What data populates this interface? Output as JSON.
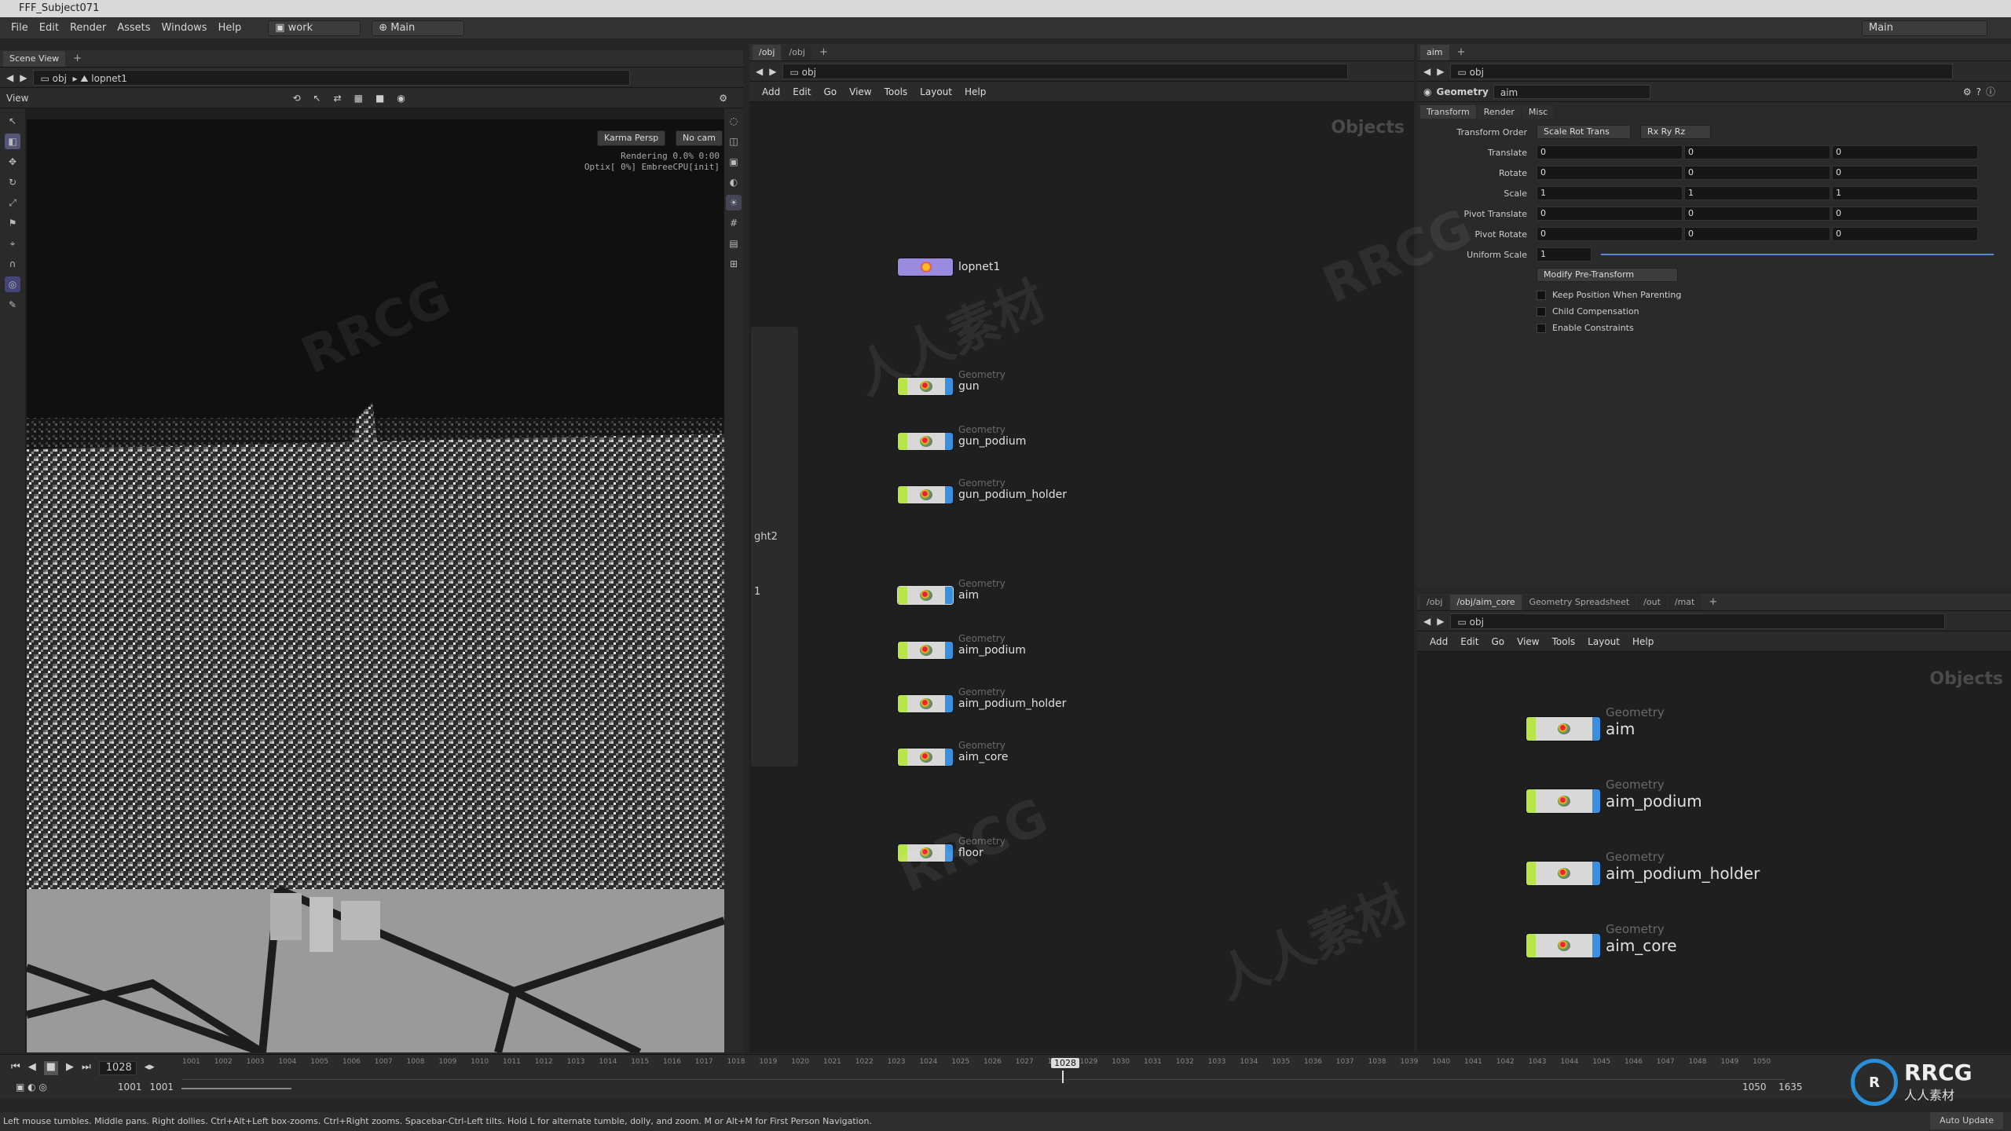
{
  "titlebar": {
    "title": "FFF_Subject071"
  },
  "menu": {
    "items": [
      "File",
      "Edit",
      "Render",
      "Assets",
      "Windows",
      "Help"
    ],
    "desktop": "work",
    "main": "Main",
    "right_main": "Main"
  },
  "scene_view": {
    "tab": "Scene View",
    "path_root": "obj",
    "path_node": "lopnet1",
    "view_label": "View",
    "renderer": "Karma Persp",
    "camera": "No cam",
    "render_status_line1": "Rendering  0.0%  0:00",
    "render_status_line2": "Optix[  0%] EmbreeCPU[init]"
  },
  "network_top": {
    "tabs": [
      "/obj",
      "/obj"
    ],
    "path": "obj",
    "menu": [
      "Add",
      "Edit",
      "Go",
      "View",
      "Tools",
      "Layout",
      "Help"
    ],
    "context_label": "Objects",
    "side_label_1": "ght2",
    "side_label_2": "1",
    "nodes": [
      {
        "type": "",
        "name": "lopnet1"
      },
      {
        "type": "Geometry",
        "name": "gun"
      },
      {
        "type": "Geometry",
        "name": "gun_podium"
      },
      {
        "type": "Geometry",
        "name": "gun_podium_holder"
      },
      {
        "type": "Geometry",
        "name": "aim"
      },
      {
        "type": "Geometry",
        "name": "aim_podium"
      },
      {
        "type": "Geometry",
        "name": "aim_podium_holder"
      },
      {
        "type": "Geometry",
        "name": "aim_core"
      },
      {
        "type": "Geometry",
        "name": "floor"
      }
    ]
  },
  "params": {
    "tab": "aim",
    "path": "obj",
    "node_type": "Geometry",
    "node_name": "aim",
    "subtabs": [
      "Transform",
      "Render",
      "Misc"
    ],
    "transform_order_label": "Transform Order",
    "transform_order": "Scale Rot Trans",
    "rot_order": "Rx Ry Rz",
    "rows": [
      {
        "label": "Translate",
        "values": [
          "0",
          "0",
          "0"
        ]
      },
      {
        "label": "Rotate",
        "values": [
          "0",
          "0",
          "0"
        ]
      },
      {
        "label": "Scale",
        "values": [
          "1",
          "1",
          "1"
        ]
      },
      {
        "label": "Pivot Translate",
        "values": [
          "0",
          "0",
          "0"
        ]
      },
      {
        "label": "Pivot Rotate",
        "values": [
          "0",
          "0",
          "0"
        ]
      }
    ],
    "uniform_scale_label": "Uniform Scale",
    "uniform_scale": "1",
    "modify_button": "Modify Pre-Transform",
    "checks": [
      "Keep Position When Parenting",
      "Child Compensation",
      "Enable Constraints"
    ]
  },
  "network_bottom": {
    "tabs": [
      "/obj",
      "/obj/aim_core",
      "Geometry Spreadsheet",
      "/out",
      "/mat"
    ],
    "path": "obj",
    "menu": [
      "Add",
      "Edit",
      "Go",
      "View",
      "Tools",
      "Layout",
      "Help"
    ],
    "context_label": "Objects",
    "nodes": [
      {
        "type": "Geometry",
        "name": "aim"
      },
      {
        "type": "Geometry",
        "name": "aim_podium"
      },
      {
        "type": "Geometry",
        "name": "aim_podium_holder"
      },
      {
        "type": "Geometry",
        "name": "aim_core"
      }
    ]
  },
  "timeline": {
    "current_frame": "1028",
    "start": "1001",
    "start2": "1001",
    "end": "1050",
    "end2": "1635",
    "ticks": [
      "1001",
      "1002",
      "1003",
      "1004",
      "1005",
      "1006",
      "1007",
      "1008",
      "1009",
      "1010",
      "1011",
      "1012",
      "1013",
      "1014",
      "1015",
      "1016",
      "1017",
      "1018",
      "1019",
      "1020",
      "1021",
      "1022",
      "1023",
      "1024",
      "1025",
      "1026",
      "1027",
      "1028",
      "1029",
      "1030",
      "1031",
      "1032",
      "1033",
      "1034",
      "1035",
      "1036",
      "1037",
      "1038",
      "1039",
      "1040",
      "1041",
      "1042",
      "1043",
      "1044",
      "1045",
      "1046",
      "1047",
      "1048",
      "1049",
      "1050"
    ]
  },
  "status": {
    "message": "Left mouse tumbles. Middle pans. Right dollies. Ctrl+Alt+Left box-zooms. Ctrl+Right zooms. Spacebar-Ctrl-Left tilts. Hold L for alternate tumble, dolly, and zoom.    M or Alt+M for First Person Navigation.",
    "auto_update": "Auto Update"
  },
  "watermark": {
    "text1": "RRCG",
    "text2": "人人素材",
    "logo": "RRCG",
    "logo_sub": "人人素材"
  },
  "colors": {
    "node_left": "#b8e64a",
    "node_right": "#3a90e0",
    "lopnet": "#9a8ae0"
  }
}
